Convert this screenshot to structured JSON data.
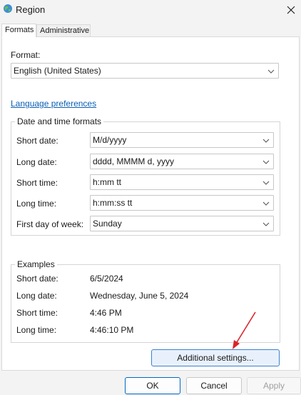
{
  "window": {
    "title": "Region",
    "app_icon": "globe-icon",
    "close_icon": "close-icon"
  },
  "tabs": [
    {
      "label": "Formats",
      "active": true
    },
    {
      "label": "Administrative",
      "active": false
    }
  ],
  "format": {
    "label": "Format:",
    "value": "English (United States)"
  },
  "language_link": "Language preferences",
  "datetime_group": {
    "title": "Date and time formats",
    "rows": [
      {
        "label": "Short date:",
        "value": "M/d/yyyy"
      },
      {
        "label": "Long date:",
        "value": "dddd, MMMM d, yyyy"
      },
      {
        "label": "Short time:",
        "value": "h:mm tt"
      },
      {
        "label": "Long time:",
        "value": "h:mm:ss tt"
      },
      {
        "label": "First day of week:",
        "value": "Sunday"
      }
    ]
  },
  "examples_group": {
    "title": "Examples",
    "rows": [
      {
        "label": "Short date:",
        "value": "6/5/2024"
      },
      {
        "label": "Long date:",
        "value": "Wednesday, June 5, 2024"
      },
      {
        "label": "Short time:",
        "value": "4:46 PM"
      },
      {
        "label": "Long time:",
        "value": "4:46:10 PM"
      }
    ]
  },
  "buttons": {
    "additional": "Additional settings...",
    "ok": "OK",
    "cancel": "Cancel",
    "apply": "Apply"
  },
  "colors": {
    "link": "#0a5fb4",
    "accent": "#0067c0",
    "annotation_arrow": "#d9262c"
  }
}
